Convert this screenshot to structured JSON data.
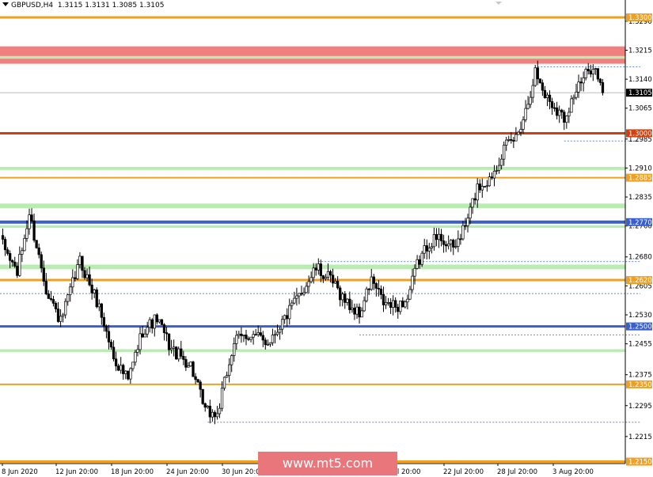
{
  "header": {
    "symbol": "GBPUSD,H4",
    "ohlc": "1.3115 1.3131 1.3085 1.3105"
  },
  "watermark": "www.mt5.com",
  "colors": {
    "red_zone": "#f08080",
    "green_zone": "#b8ecb0",
    "orange": "#f0a020",
    "red_level": "#d04010",
    "blue": "#3a5fcd",
    "dotted": "#6a8ac8",
    "candle": "#000000",
    "current_price_line": "#bdbdbd"
  },
  "chart_data": {
    "type": "candlestick",
    "symbol": "GBPUSD",
    "timeframe": "H4",
    "ylim": [
      1.2145,
      1.3345
    ],
    "y_ticks": [
      "1.3290",
      "1.3215",
      "1.3140",
      "1.3065",
      "1.2985",
      "1.2910",
      "1.2835",
      "1.2760",
      "1.2680",
      "1.2605",
      "1.2530",
      "1.2455",
      "1.2375",
      "1.2295",
      "1.2215"
    ],
    "x_ticks": [
      "8 Jun 2020",
      "12 Jun 20:00",
      "18 Jun 20:00",
      "24 Jun 20:00",
      "30 Jun 20:00",
      "Jul 20:00",
      "22 Jul 20:00",
      "28 Jul 20:00",
      "3 Aug 20:00"
    ],
    "current_price": "1.3105",
    "zones": [
      {
        "from": 1.318,
        "to": 1.3225,
        "color": "red"
      },
      {
        "from": 1.3193,
        "to": 1.32,
        "color": "green"
      },
      {
        "from": 1.2905,
        "to": 1.2913,
        "color": "green"
      },
      {
        "from": 1.2806,
        "to": 1.2818,
        "color": "green"
      },
      {
        "from": 1.2755,
        "to": 1.2762,
        "color": "green"
      },
      {
        "from": 1.2648,
        "to": 1.266,
        "color": "green"
      },
      {
        "from": 1.2434,
        "to": 1.2441,
        "color": "green"
      }
    ],
    "levels": [
      {
        "price": 1.33,
        "label": "1.3300",
        "color": "orange",
        "width": 3
      },
      {
        "price": 1.3,
        "label": "1.3000",
        "color": "red_level",
        "width": 3
      },
      {
        "price": 1.2885,
        "label": "1.2885",
        "color": "orange",
        "width": 2
      },
      {
        "price": 1.277,
        "label": "1.2770",
        "color": "blue",
        "width": 4
      },
      {
        "price": 1.262,
        "label": "1.2620",
        "color": "orange",
        "width": 3
      },
      {
        "price": 1.25,
        "label": "1.2500",
        "color": "blue",
        "width": 3
      },
      {
        "price": 1.235,
        "label": "1.2350",
        "color": "orange",
        "width": 2
      },
      {
        "price": 1.215,
        "label": "1.2150",
        "color": "orange",
        "width": 3
      }
    ],
    "dotted_lines": [
      {
        "price": 1.3172,
        "from_bar": 222,
        "to_bar": 258
      },
      {
        "price": 1.298,
        "from_bar": 233,
        "to_bar": 258
      },
      {
        "price": 1.2668,
        "from_bar": 131,
        "to_bar": 258
      },
      {
        "price": 1.2585,
        "from_bar": 0,
        "to_bar": 258
      },
      {
        "price": 1.2478,
        "from_bar": 148,
        "to_bar": 258
      },
      {
        "price": 1.2252,
        "from_bar": 85,
        "to_bar": 258
      }
    ],
    "anchors": [
      [
        0,
        1.271
      ],
      [
        6,
        1.264
      ],
      [
        11,
        1.279
      ],
      [
        18,
        1.26
      ],
      [
        24,
        1.251
      ],
      [
        32,
        1.267
      ],
      [
        40,
        1.255
      ],
      [
        46,
        1.242
      ],
      [
        52,
        1.236
      ],
      [
        58,
        1.249
      ],
      [
        64,
        1.252
      ],
      [
        70,
        1.244
      ],
      [
        78,
        1.24
      ],
      [
        84,
        1.228
      ],
      [
        89,
        1.227
      ],
      [
        96,
        1.246
      ],
      [
        102,
        1.248
      ],
      [
        110,
        1.246
      ],
      [
        118,
        1.253
      ],
      [
        124,
        1.259
      ],
      [
        130,
        1.265
      ],
      [
        136,
        1.262
      ],
      [
        143,
        1.256
      ],
      [
        148,
        1.253
      ],
      [
        153,
        1.262
      ],
      [
        158,
        1.256
      ],
      [
        163,
        1.255
      ],
      [
        168,
        1.257
      ],
      [
        172,
        1.266
      ],
      [
        177,
        1.272
      ],
      [
        182,
        1.273
      ],
      [
        187,
        1.27
      ],
      [
        192,
        1.276
      ],
      [
        197,
        1.286
      ],
      [
        202,
        1.288
      ],
      [
        208,
        1.296
      ],
      [
        213,
        1.299
      ],
      [
        217,
        1.306
      ],
      [
        221,
        1.316
      ],
      [
        225,
        1.31
      ],
      [
        229,
        1.307
      ],
      [
        233,
        1.304
      ],
      [
        237,
        1.31
      ],
      [
        241,
        1.314
      ],
      [
        245,
        1.318
      ],
      [
        249,
        1.3105
      ]
    ]
  }
}
